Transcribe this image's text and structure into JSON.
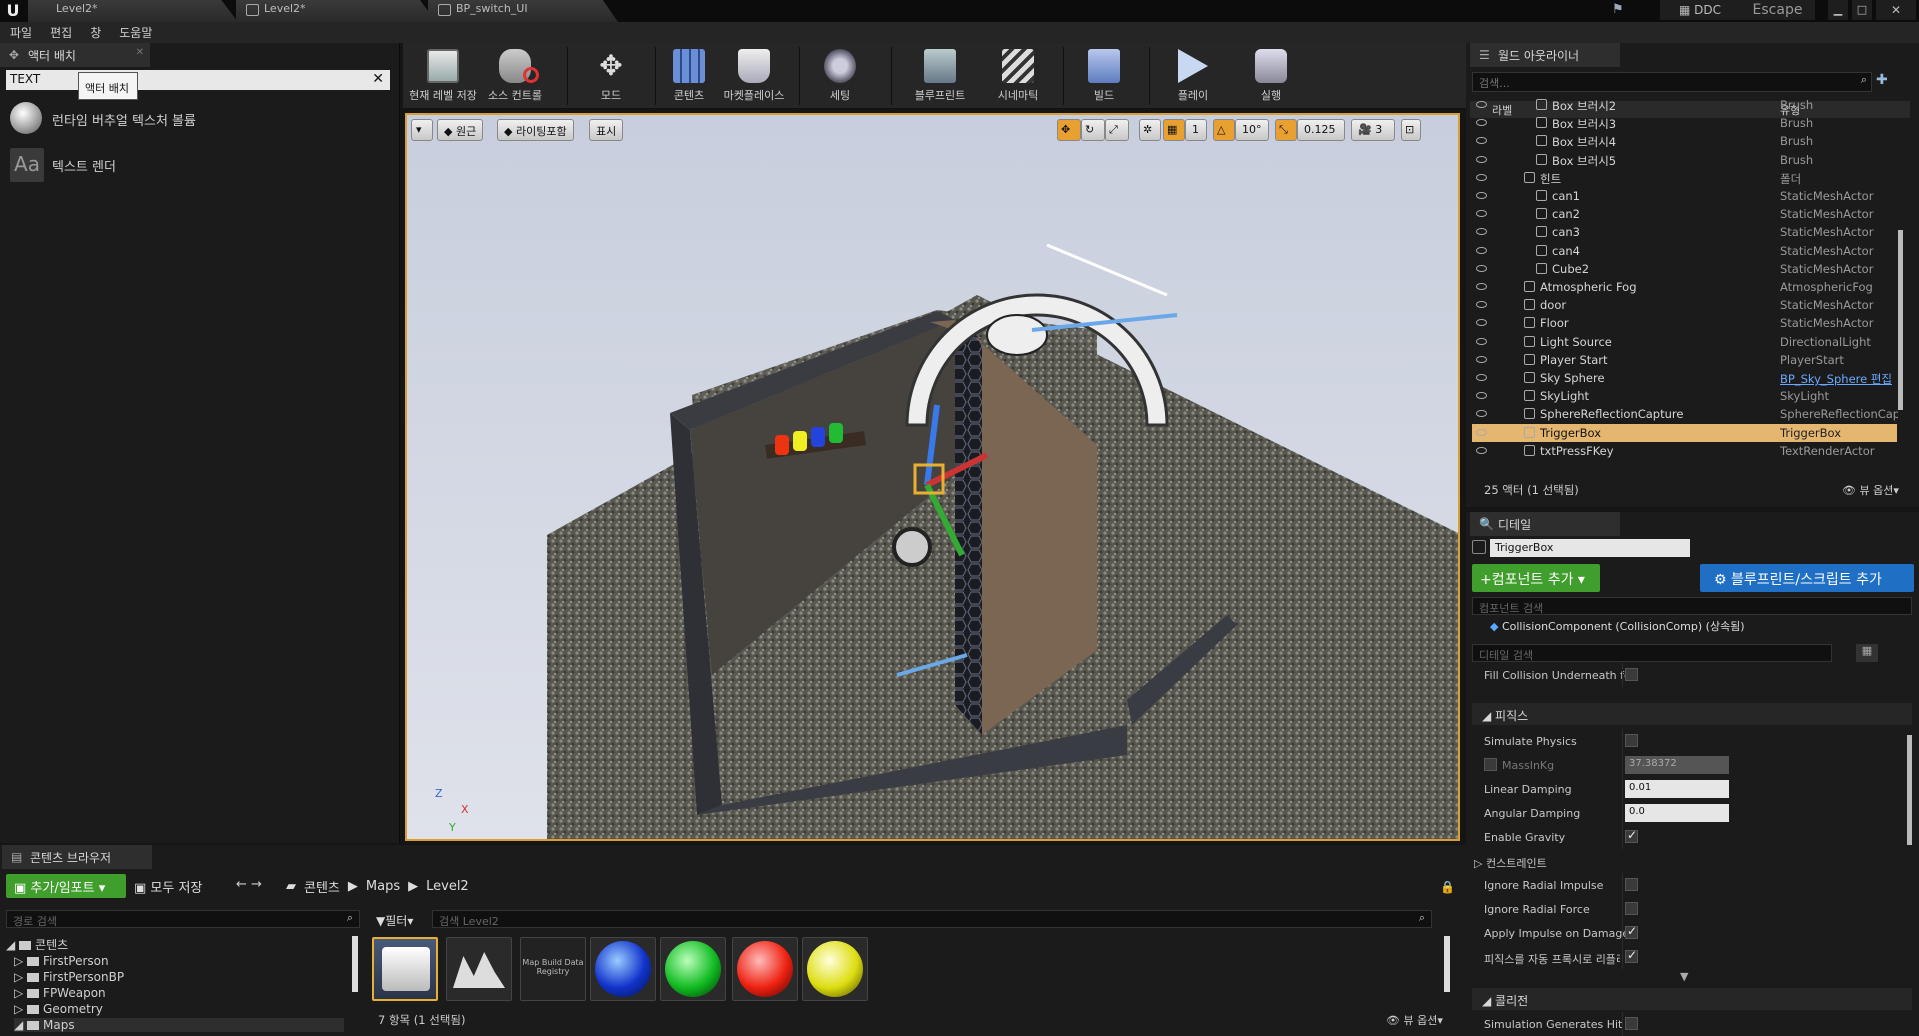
{
  "titlebar": {
    "tabs": [
      "Level2*",
      "Level2*",
      "BP_switch_UI"
    ],
    "ddc": "DDC",
    "escape": "Escape"
  },
  "menu": [
    "파일",
    "편집",
    "창",
    "도움말"
  ],
  "place_actors": {
    "tab": "액터 배치",
    "search_value": "TEXT",
    "tooltip": "액터 배치",
    "items": [
      "런타임 버추얼 텍스처 볼륨",
      "텍스트 렌더"
    ]
  },
  "toolbar": {
    "items": [
      "현재 레벨 저장",
      "소스 컨트롤",
      "모드",
      "콘텐츠",
      "마켓플레이스",
      "세팅",
      "블루프린트",
      "시네마틱",
      "빌드",
      "플레이",
      "실행"
    ]
  },
  "viewport": {
    "perspective": "원근",
    "lighting": "라이팅포함",
    "show": "표시",
    "grid_snap": "1",
    "rot_snap": "10°",
    "scale_snap": "0.125",
    "cam_speed": "3",
    "axis_x": "X",
    "axis_z": "Z",
    "axis_y": "Y"
  },
  "outliner": {
    "tab": "월드 아웃라이너",
    "search_placeholder": "검색...",
    "col_label": "라벨",
    "col_type": "유형",
    "rows": [
      {
        "name": "Box 브러시2",
        "type": "Brush"
      },
      {
        "name": "Box 브러시3",
        "type": "Brush"
      },
      {
        "name": "Box 브러시4",
        "type": "Brush"
      },
      {
        "name": "Box 브러시5",
        "type": "Brush"
      },
      {
        "name": "힌트",
        "type": "폴더"
      },
      {
        "name": "can1",
        "type": "StaticMeshActor"
      },
      {
        "name": "can2",
        "type": "StaticMeshActor"
      },
      {
        "name": "can3",
        "type": "StaticMeshActor"
      },
      {
        "name": "can4",
        "type": "StaticMeshActor"
      },
      {
        "name": "Cube2",
        "type": "StaticMeshActor"
      },
      {
        "name": "Atmospheric Fog",
        "type": "AtmosphericFog"
      },
      {
        "name": "door",
        "type": "StaticMeshActor"
      },
      {
        "name": "Floor",
        "type": "StaticMeshActor"
      },
      {
        "name": "Light Source",
        "type": "DirectionalLight"
      },
      {
        "name": "Player Start",
        "type": "PlayerStart"
      },
      {
        "name": "Sky Sphere",
        "type": "BP_Sky_Sphere 편집"
      },
      {
        "name": "SkyLight",
        "type": "SkyLight"
      },
      {
        "name": "SphereReflectionCapture",
        "type": "SphereReflectionCapture"
      },
      {
        "name": "TriggerBox",
        "type": "TriggerBox"
      },
      {
        "name": "txtPressFKey",
        "type": "TextRenderActor"
      }
    ],
    "count": "25 액터 (1 선택됨)",
    "view_options": "뷰 옵션"
  },
  "details": {
    "tab": "디테일",
    "name_value": "TriggerBox",
    "add_component": "+컴포넌트 추가",
    "add_blueprint": "블루프린트/스크립트 추가",
    "component_search_placeholder": "컴포넌트 검색",
    "component": "CollisionComponent (CollisionComp) (상속됨)",
    "detail_search_placeholder": "디테일 검색",
    "fill_collision": "Fill Collision Underneath fo",
    "physics_header": "피직스",
    "simulate_physics": "Simulate Physics",
    "mass_label": "MassInKg",
    "mass_value": "37.38372",
    "linear_damping": "Linear Damping",
    "linear_value": "0.01",
    "angular_damping": "Angular Damping",
    "angular_value": "0.0",
    "enable_gravity": "Enable Gravity",
    "constraints": "컨스트레인트",
    "ignore_radial_impulse": "Ignore Radial Impulse",
    "ignore_radial_force": "Ignore Radial Force",
    "apply_impulse": "Apply Impulse on Damage",
    "auto_wake": "피직스를 자동 프록시로 리플리",
    "collision_header": "콜리전",
    "sim_hit": "Simulation Generates Hit E"
  },
  "content_browser": {
    "tab": "콘텐츠 브라우저",
    "add_import": "추가/임포트",
    "save_all": "모두 저장",
    "crumbs": [
      "콘텐츠",
      "Maps",
      "Level2"
    ],
    "path_search": "경로 검색",
    "filter": "필터",
    "asset_search": "검색 Level2",
    "tree": [
      "콘텐츠",
      "FirstPerson",
      "FirstPersonBP",
      "FPWeapon",
      "Geometry",
      "Maps"
    ],
    "map_build_label": "Map Build Data Registry",
    "count": "7 항목 (1 선택됨)",
    "view_options": "뷰 옵션"
  },
  "colors": {
    "selection": "#e5b670",
    "accent_green": "#3f9e2c",
    "accent_blue": "#1f6fc4"
  }
}
